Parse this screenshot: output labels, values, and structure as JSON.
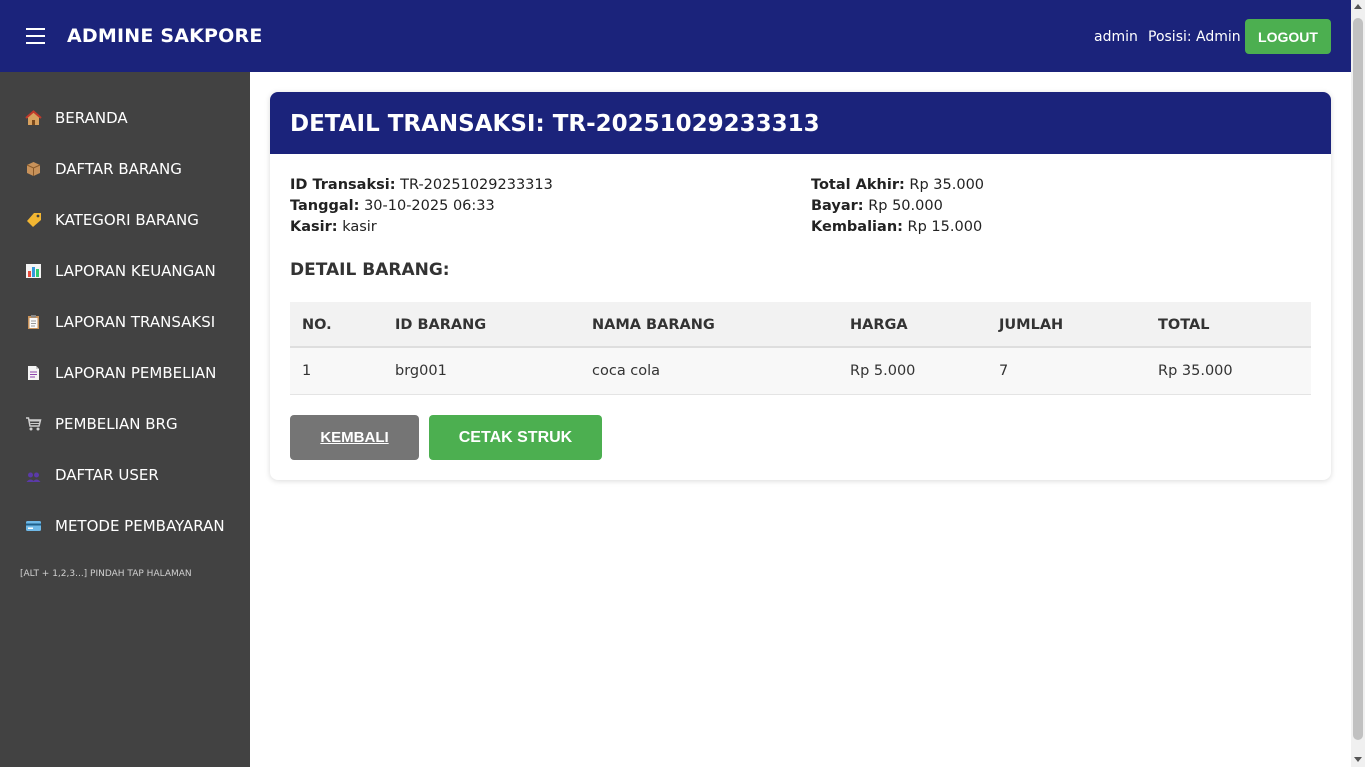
{
  "header": {
    "brand": "ADMINE SAKPORE",
    "user_name": "admin",
    "user_role": "Posisi: Admin",
    "logout_label": "LOGOUT"
  },
  "sidebar": {
    "items": [
      {
        "label": "BERANDA",
        "icon": "house-icon"
      },
      {
        "label": "DAFTAR BARANG",
        "icon": "package-icon"
      },
      {
        "label": "KATEGORI BARANG",
        "icon": "tag-icon"
      },
      {
        "label": "LAPORAN KEUANGAN",
        "icon": "bar-chart-icon"
      },
      {
        "label": "LAPORAN TRANSAKSI",
        "icon": "clipboard-icon"
      },
      {
        "label": "LAPORAN PEMBELIAN",
        "icon": "document-icon"
      },
      {
        "label": "PEMBELIAN BRG",
        "icon": "cart-icon"
      },
      {
        "label": "DAFTAR USER",
        "icon": "users-icon"
      },
      {
        "label": "METODE PEMBAYARAN",
        "icon": "credit-card-icon"
      }
    ],
    "hint": "[ALT + 1,2,3...] PINDAH TAP HALAMAN"
  },
  "detail": {
    "title": "DETAIL TRANSAKSI: TR-20251029233313",
    "id_label": "ID Transaksi:",
    "id_value": "TR-20251029233313",
    "date_label": "Tanggal:",
    "date_value": "30-10-2025 06:33",
    "cashier_label": "Kasir:",
    "cashier_value": "kasir",
    "total_label": "Total Akhir:",
    "total_value": "Rp 35.000",
    "paid_label": "Bayar:",
    "paid_value": "Rp 50.000",
    "change_label": "Kembalian:",
    "change_value": "Rp 15.000",
    "section_title": "DETAIL BARANG:"
  },
  "table": {
    "headers": [
      "NO.",
      "ID BARANG",
      "NAMA BARANG",
      "HARGA",
      "JUMLAH",
      "TOTAL"
    ],
    "rows": [
      [
        "1",
        "brg001",
        "coca cola",
        "Rp 5.000",
        "7",
        "Rp 35.000"
      ]
    ]
  },
  "actions": {
    "back_label": "KEMBALI",
    "print_label": "CETAK STRUK"
  },
  "colors": {
    "primary": "#1b237b",
    "sidebar": "#424242",
    "success": "#4caf50",
    "secondary": "#757575"
  }
}
